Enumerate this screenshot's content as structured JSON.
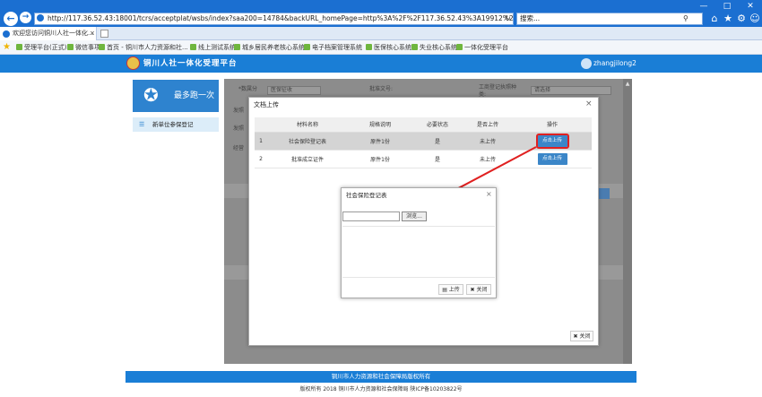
{
  "browser": {
    "url": "http://117.36.52.43:18001/tcrs/acceptplat/wsbs/index?saa200=14784&backURL_homePage=http%3A%2F%2F117.36.52.43%3A19912%2F&sbkFlag=1&u",
    "search_placeholder": "搜索...",
    "tab_title": "欢迎您访问铜川人社一体化..."
  },
  "favorites": [
    {
      "label": "受理平台(正式)"
    },
    {
      "label": "微信事项"
    },
    {
      "label": "首页 - 铜川市人力资源和社..."
    },
    {
      "label": "线上测试系统"
    },
    {
      "label": "城乡居民养老核心系统"
    },
    {
      "label": "电子档案管理系统"
    },
    {
      "label": "医保核心系统"
    },
    {
      "label": "失业核心系统"
    },
    {
      "label": "一体化受理平台"
    }
  ],
  "app": {
    "title": "铜川人社一体化受理平台",
    "user": "zhangjilong2",
    "logo_text": "最多跑一次",
    "sidebar_item": "新单位参保登记",
    "footer_line1": "铜川市人力资源和社会保障局版权所有",
    "footer_line2": "版权所有 2018 铜川市人力资源和社会保障局 陕ICP备10203822号"
  },
  "background_form": {
    "field1": "*数属分",
    "select1": "医保征收",
    "field2": "批准文号:",
    "field3": "工商登记执照种类:",
    "select3": "请选择",
    "row_label1": "发照",
    "row_label2": "发照",
    "row_label3": "经营"
  },
  "upload_dialog": {
    "title": "文档上传",
    "columns": [
      "材料名称",
      "规格说明",
      "必要状态",
      "是否上传",
      "操作"
    ],
    "rows": [
      {
        "no": "1",
        "name": "社会保险登记表",
        "spec": "原件1份",
        "required": "是",
        "uploaded": "未上传",
        "action": "点击上传"
      },
      {
        "no": "2",
        "name": "批准成立证件",
        "spec": "原件1份",
        "required": "是",
        "uploaded": "未上传",
        "action": "点击上传"
      }
    ],
    "close_label": "关闭"
  },
  "sheet_dialog": {
    "title": "社会保险登记表",
    "browse_label": "浏览...",
    "upload_label": "上传",
    "close_label": "关闭"
  },
  "colors": {
    "accent": "#1a7ed6",
    "highlight": "#e02020"
  }
}
